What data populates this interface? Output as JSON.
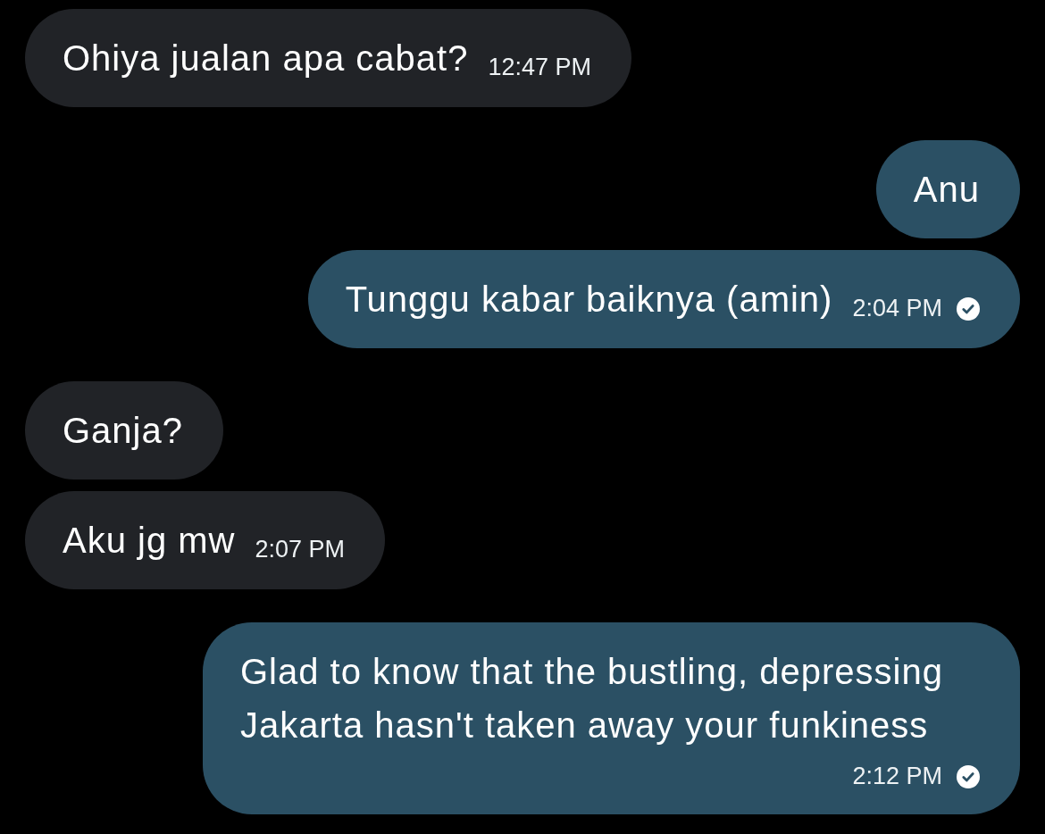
{
  "messages": [
    {
      "kind": "incoming",
      "text": "Ohiya jualan apa cabat?",
      "time": "12:47 PM"
    },
    {
      "kind": "outgoing",
      "text": "Anu"
    },
    {
      "kind": "outgoing",
      "text": "Tunggu kabar baiknya (amin)",
      "time": "2:04 PM",
      "read": true
    },
    {
      "kind": "incoming",
      "text": "Ganja?"
    },
    {
      "kind": "incoming",
      "text": "Aku jg mw",
      "time": "2:07 PM"
    },
    {
      "kind": "outgoing",
      "text": "Glad to know that the bustling, depressing Jakarta hasn't taken away your funkiness",
      "time": "2:12 PM",
      "read": true
    }
  ]
}
